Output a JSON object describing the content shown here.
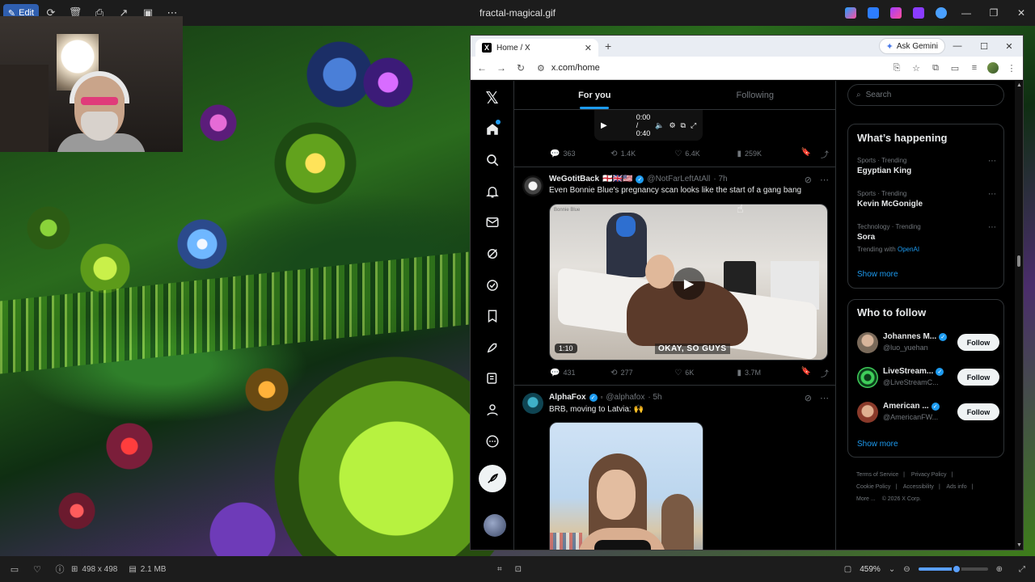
{
  "viewer": {
    "title": "fractal-magical.gif",
    "edit_label": "Edit",
    "image_dims": "498 x 498",
    "file_size": "2.1 MB",
    "zoom": "459%",
    "zoom_level": 0.55,
    "accent": "#5aa0ff"
  },
  "browser": {
    "tab_title": "Home / X",
    "url": "x.com/home",
    "gemini_label": "Ask Gemini",
    "new_tab": "+",
    "close_tab": "✕"
  },
  "x": {
    "logo": "𝕏",
    "tabs": [
      {
        "label": "For you",
        "active": true
      },
      {
        "label": "Following",
        "active": false
      }
    ],
    "prev_video": {
      "time": "0:00 / 0:40",
      "replies": "363",
      "reposts": "1.4K",
      "likes": "6.4K",
      "views": "259K"
    },
    "posts": [
      {
        "name": "WeGotitBack",
        "flags": "🏴󠁧󠁢󠁥󠁮󠁧󠁿🇬🇧🇺🇸",
        "handle": "@NotFarLeftAtAll",
        "time": "· 7h",
        "text": "Even Bonnie Blue's pregnancy scan looks like the start of a gang bang",
        "media_caption": "OKAY, SO GUYS",
        "media_duration": "1:10",
        "media_watermark": "Bonnie Blue",
        "replies": "431",
        "reposts": "277",
        "likes": "6K",
        "views": "3.7M"
      },
      {
        "name": "AlphaFox",
        "handle": "@alphafox",
        "time": "· 5h",
        "text": "BRB, moving to Latvia: 🙌"
      }
    ],
    "search_placeholder": "Search",
    "trends_title": "What’s happening",
    "trends": [
      {
        "meta": "Sports · Trending",
        "topic": "Egyptian King",
        "sub": ""
      },
      {
        "meta": "Sports · Trending",
        "topic": "Kevin McGonigle",
        "sub": ""
      },
      {
        "meta": "Technology · Trending",
        "topic": "Sora",
        "sub_prefix": "Trending with",
        "sub_link": "OpenAI"
      }
    ],
    "show_more": "Show more",
    "wtf_title": "Who to follow",
    "follow_label": "Follow",
    "who_to_follow": [
      {
        "name": "Johannes M...",
        "handle": "@luo_yuehan"
      },
      {
        "name": "LiveStream...",
        "handle": "@LiveStreamC..."
      },
      {
        "name": "American ...",
        "handle": "@AmericanFW..."
      }
    ],
    "footer": {
      "terms": "Terms of Service",
      "privacy": "Privacy Policy",
      "cookie": "Cookie Policy",
      "accessibility": "Accessibility",
      "ads": "Ads info",
      "more": "More ...",
      "copyright": "© 2026 X Corp."
    },
    "accent": "#1d9bf0"
  }
}
